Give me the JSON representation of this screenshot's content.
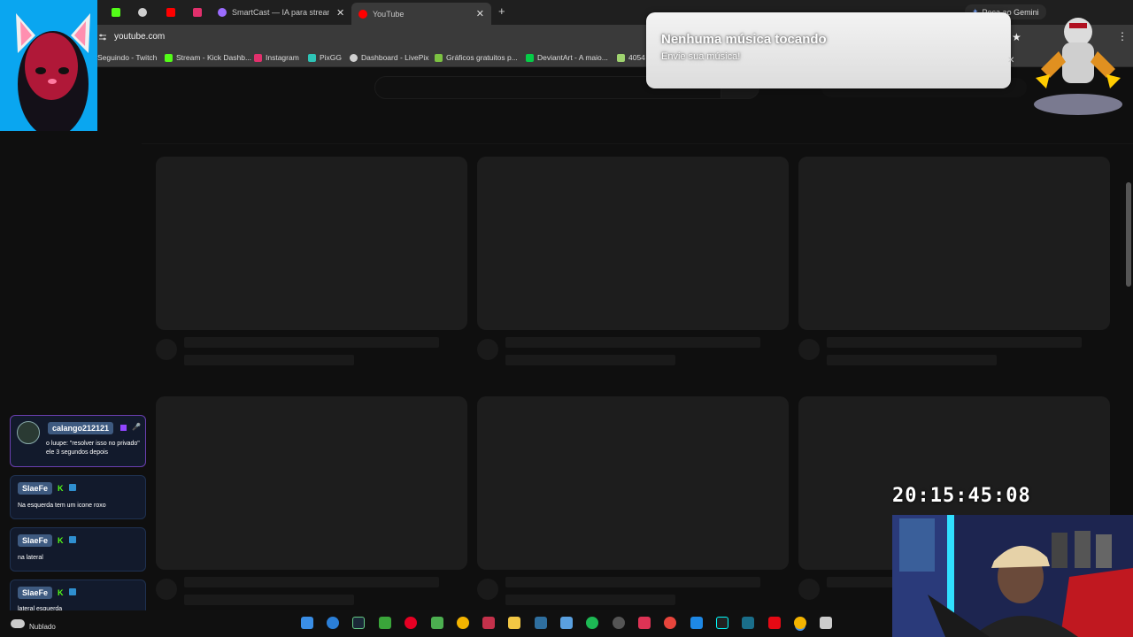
{
  "browser": {
    "tabs": [
      {
        "label": "SmartCast — IA para streamers",
        "icon": "smartcast-icon",
        "color": "#9b6cff"
      },
      {
        "label": "YouTube",
        "icon": "youtube-icon",
        "color": "#ff0000",
        "active": true
      }
    ],
    "gemini_label": "Peça ao Gemini",
    "url": "youtube.com",
    "bookmarks": [
      {
        "label": "Seguindo - Twitch",
        "color": "#9146ff"
      },
      {
        "label": "Stream - Kick Dashb...",
        "color": "#53fc18"
      },
      {
        "label": "Instagram",
        "color": "#e1306c"
      },
      {
        "label": "PixGG",
        "color": "#2ec4b6"
      },
      {
        "label": "Dashboard - LivePix",
        "color": "#d0d0d0"
      },
      {
        "label": "Gráficos gratuitos p...",
        "color": "#7cc242"
      },
      {
        "label": "DeviantArt - A maio...",
        "color": "#05cc47"
      },
      {
        "label": "4054",
        "color": "#9fd36f"
      }
    ]
  },
  "notification": {
    "title": "Nenhuma música tocando",
    "subtitle": "Envie sua música!"
  },
  "chat": [
    {
      "user": "calango212121",
      "message": "o luupe: \"resolver isso no privado\" ele 3 segundos depois"
    },
    {
      "user": "SlaeFe",
      "message": "Na esquerda tem um icone roxo"
    },
    {
      "user": "SlaeFe",
      "message": "na lateral"
    },
    {
      "user": "SlaeFe",
      "message": "lateral esquerda"
    }
  ],
  "weather": "Nublado",
  "clock": "20:15:45:08"
}
